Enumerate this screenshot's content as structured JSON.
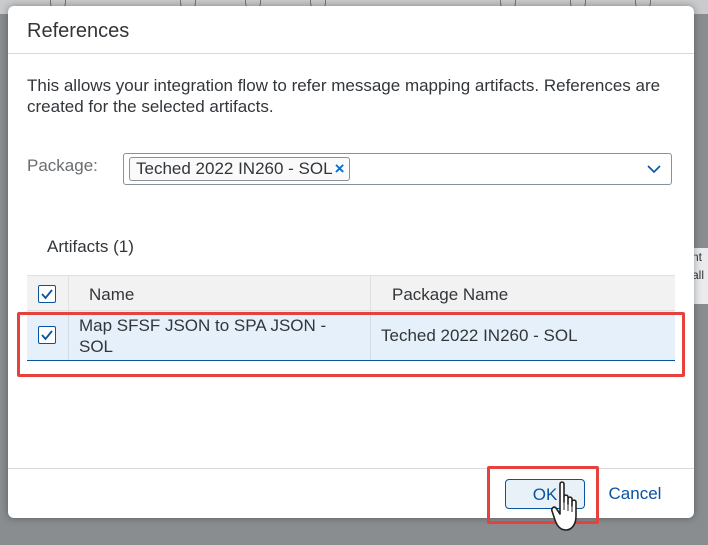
{
  "background": {
    "right_card_text": "nt\nall"
  },
  "dialog": {
    "title": "References",
    "description": "This allows your integration flow to refer message mapping artifacts. References are created for the selected artifacts.",
    "package": {
      "label": "Package:",
      "selected_token": "Teched 2022 IN260 - SOL",
      "token_remove_icon": "close-icon",
      "dropdown_icon": "chevron-down-icon"
    },
    "artifacts": {
      "title": "Artifacts (1)",
      "columns": [
        "Name",
        "Package Name"
      ],
      "rows": [
        {
          "checked": true,
          "name": "Map SFSF JSON to SPA JSON - SOL",
          "package_name": "Teched 2022 IN260 - SOL"
        }
      ]
    },
    "footer": {
      "ok_label": "OK",
      "cancel_label": "Cancel"
    }
  },
  "colors": {
    "accent": "#0854a0",
    "highlight": "#e5423d",
    "selected_row": "#e5f0fa"
  }
}
